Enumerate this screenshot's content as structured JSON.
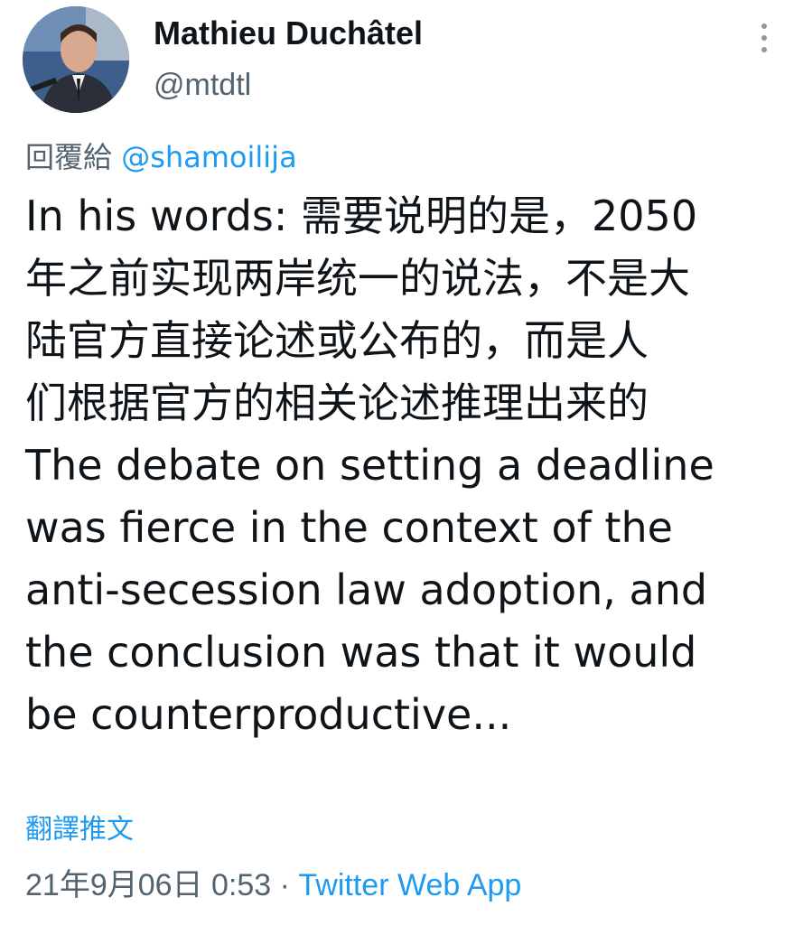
{
  "author": {
    "display_name": "Mathieu Duchâtel",
    "handle": "@mtdtl",
    "avatar_icon": "user-avatar-photo"
  },
  "more_icon": "more-vertical-icon",
  "reply": {
    "prefix": "回覆給",
    "mention": "@shamoilija"
  },
  "tweet": {
    "lines": [
      "In his words: 需要说明的是，2050",
      "年之前实现两岸统一的说法，不是大",
      "陆官方直接论述或公布的，而是人",
      "们根据官方的相关论述推理出来的",
      "The debate on setting a deadline",
      "was fierce in the context of the",
      "anti-secession law adoption, and",
      "the conclusion was that it would",
      "be counterproductive..."
    ]
  },
  "translate_label": "翻譯推文",
  "meta": {
    "timestamp": "21年9月06日 0:53",
    "separator": "·",
    "source": "Twitter Web App"
  },
  "colors": {
    "accent": "#1d9bf0",
    "secondary_text": "#536471",
    "primary_text": "#0f1419"
  }
}
